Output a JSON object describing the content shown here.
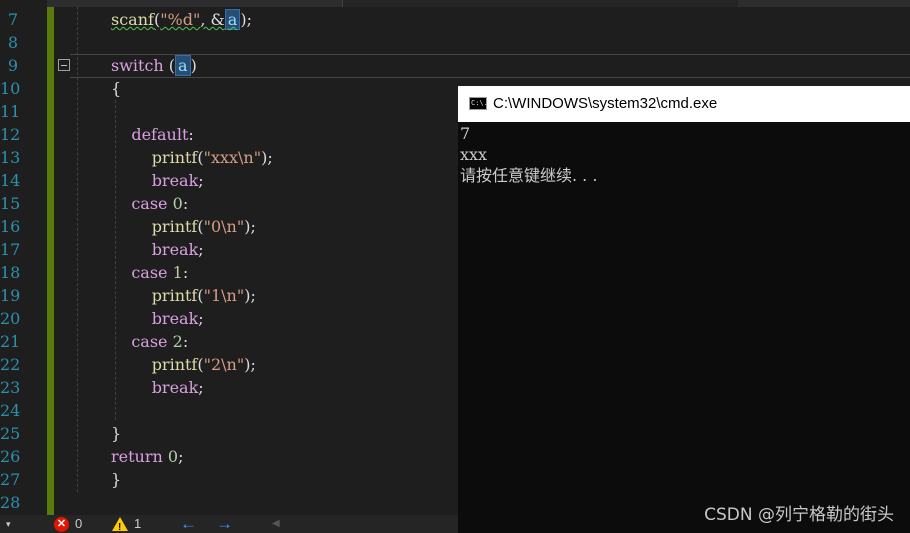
{
  "editor": {
    "lines": [
      {
        "n": "7",
        "code": [
          {
            "t": "scanf",
            "c": "fn squig"
          },
          {
            "t": "(",
            "c": "squig"
          },
          {
            "t": "\"%d\"",
            "c": "str squig"
          },
          {
            "t": ", &",
            "c": "squig"
          },
          {
            "t": "a",
            "c": "var hl squig"
          },
          {
            "t": ");",
            "c": ""
          }
        ]
      },
      {
        "n": "8",
        "code": []
      },
      {
        "n": "9",
        "code": [
          {
            "t": "switch",
            "c": "kw"
          },
          {
            "t": " (",
            "c": ""
          },
          {
            "t": "a",
            "c": "var hl"
          },
          {
            "t": ")",
            "c": ""
          }
        ]
      },
      {
        "n": "10",
        "code": [
          {
            "t": "{",
            "c": ""
          }
        ]
      },
      {
        "n": "11",
        "code": []
      },
      {
        "n": "12",
        "code": [
          {
            "t": "    default",
            "c": "kw"
          },
          {
            "t": ":",
            "c": ""
          }
        ]
      },
      {
        "n": "13",
        "code": [
          {
            "t": "        printf",
            "c": "fn"
          },
          {
            "t": "(",
            "c": ""
          },
          {
            "t": "\"xxx\\n\"",
            "c": "str"
          },
          {
            "t": ");",
            "c": ""
          }
        ]
      },
      {
        "n": "14",
        "code": [
          {
            "t": "        break",
            "c": "kw"
          },
          {
            "t": ";",
            "c": ""
          }
        ]
      },
      {
        "n": "15",
        "code": [
          {
            "t": "    case",
            "c": "kw"
          },
          {
            "t": " ",
            "c": ""
          },
          {
            "t": "0",
            "c": "num"
          },
          {
            "t": ":",
            "c": ""
          }
        ]
      },
      {
        "n": "16",
        "code": [
          {
            "t": "        printf",
            "c": "fn"
          },
          {
            "t": "(",
            "c": ""
          },
          {
            "t": "\"0\\n\"",
            "c": "str"
          },
          {
            "t": ");",
            "c": ""
          }
        ]
      },
      {
        "n": "17",
        "code": [
          {
            "t": "        break",
            "c": "kw"
          },
          {
            "t": ";",
            "c": ""
          }
        ]
      },
      {
        "n": "18",
        "code": [
          {
            "t": "    case",
            "c": "kw"
          },
          {
            "t": " ",
            "c": ""
          },
          {
            "t": "1",
            "c": "num"
          },
          {
            "t": ":",
            "c": ""
          }
        ]
      },
      {
        "n": "19",
        "code": [
          {
            "t": "        printf",
            "c": "fn"
          },
          {
            "t": "(",
            "c": ""
          },
          {
            "t": "\"1\\n\"",
            "c": "str"
          },
          {
            "t": ");",
            "c": ""
          }
        ]
      },
      {
        "n": "20",
        "code": [
          {
            "t": "        break",
            "c": "kw"
          },
          {
            "t": ";",
            "c": ""
          }
        ]
      },
      {
        "n": "21",
        "code": [
          {
            "t": "    case",
            "c": "kw"
          },
          {
            "t": " ",
            "c": ""
          },
          {
            "t": "2",
            "c": "num"
          },
          {
            "t": ":",
            "c": ""
          }
        ]
      },
      {
        "n": "22",
        "code": [
          {
            "t": "        printf",
            "c": "fn"
          },
          {
            "t": "(",
            "c": ""
          },
          {
            "t": "\"2\\n\"",
            "c": "str"
          },
          {
            "t": ");",
            "c": ""
          }
        ]
      },
      {
        "n": "23",
        "code": [
          {
            "t": "        break",
            "c": "kw"
          },
          {
            "t": ";",
            "c": ""
          }
        ]
      },
      {
        "n": "24",
        "code": []
      },
      {
        "n": "25",
        "code": [
          {
            "t": "}",
            "c": ""
          }
        ]
      },
      {
        "n": "26",
        "code": [
          {
            "t": "return",
            "c": "kw"
          },
          {
            "t": " ",
            "c": ""
          },
          {
            "t": "0",
            "c": "num"
          },
          {
            "t": ";",
            "c": ""
          }
        ]
      },
      {
        "n": "27",
        "code": [
          {
            "t": "}",
            "c": ""
          }
        ]
      },
      {
        "n": "28",
        "code": []
      }
    ]
  },
  "status": {
    "errors": "0",
    "warnings": "1",
    "back_arrow": "←",
    "forward_arrow": "→"
  },
  "console": {
    "title": "C:\\WINDOWS\\system32\\cmd.exe",
    "icon_text": "C:\\.",
    "output": "7\nxxx\n请按任意键继续. . ."
  },
  "watermark": "CSDN @列宁格勒的街头",
  "icons": {
    "collapse": "collapse-minus-icon",
    "error": "error-icon",
    "warning": "warning-icon",
    "cmd": "cmd-window-icon"
  },
  "colors": {
    "background": "#1e1e1e",
    "change_bar": "#587c0c",
    "line_number": "#2b91af",
    "keyword": "#d8a0df",
    "function": "#dcdcaa",
    "string": "#d69d85",
    "console_bg": "#0c0c0c"
  }
}
